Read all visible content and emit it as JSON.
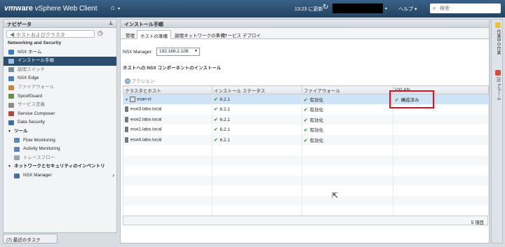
{
  "header": {
    "brand_vm": "vm",
    "brand_ware": "ware",
    "brand_product": " vSphere Web Client",
    "home_icon": "home-icon",
    "updated_text": "13:23 に更新",
    "refresh_icon": "refresh-icon",
    "help_label": "ヘルプ ▾",
    "search_placeholder": "検索",
    "colors": {
      "topbar": "#2c4d6e"
    }
  },
  "navigator": {
    "title": "ナビゲータ",
    "back_label": "◀ ホストおよびクラスタ",
    "items": [
      {
        "label": "Networking and Security",
        "kind": "top"
      },
      {
        "label": "NSX ホーム",
        "icon": "nsx-home-icon",
        "color": "#3a78c2"
      },
      {
        "label": "インストール手順",
        "icon": "install-icon",
        "color": "#5a8fd0",
        "selected": true
      },
      {
        "label": "論理スイッチ",
        "icon": "logical-switch-icon",
        "color": "#7a8a99",
        "dim": true
      },
      {
        "label": "NSX Edge",
        "icon": "nsx-edge-icon",
        "color": "#4f7fb0"
      },
      {
        "label": "ファイアウォール",
        "icon": "firewall-icon",
        "color": "#c8843a",
        "dim": true
      },
      {
        "label": "SpoofGuard",
        "icon": "spoofguard-icon",
        "color": "#6b8e4e"
      },
      {
        "label": "サービス定義",
        "icon": "service-definition-icon",
        "color": "#8a8a8a",
        "dim": true
      },
      {
        "label": "Service Composer",
        "icon": "service-composer-icon",
        "color": "#b04a3a"
      },
      {
        "label": "Data Security",
        "icon": "data-security-icon",
        "color": "#3a6fa8"
      }
    ],
    "tools_section": "ツール",
    "tools": [
      {
        "label": "Flow Monitoring",
        "icon": "flow-monitoring-icon"
      },
      {
        "label": "Activity Monitoring",
        "icon": "activity-monitoring-icon"
      },
      {
        "label": "トレースフロー",
        "icon": "traceflow-icon",
        "dim": true
      }
    ],
    "inventory_section": "ネットワークとセキュリティのインベントリ",
    "inventory": [
      {
        "label": "NSX Manager",
        "icon": "nsx-manager-icon"
      }
    ]
  },
  "recent_tasks": "(7) 最近のタスク",
  "main": {
    "title": "インストール手順",
    "tabs": [
      "管理",
      "ホストの準備",
      "論理ネットワークの準備",
      "サービス デプロイ"
    ],
    "active_tab": 1,
    "nsx_manager_label": "NSX Manager:",
    "nsx_manager_value": "192.168.2.108",
    "section_title": "ホストへの NSX コンポーネントのインストール",
    "actions_label": "アクション",
    "columns": [
      "クラスタとホスト",
      "インストール ステータス",
      "ファイアウォール",
      "VXLAN"
    ],
    "rows": [
      {
        "name": "vsan-cl",
        "type": "cluster",
        "install": "6.2.1",
        "firewall": "有効化",
        "vxlan": "構成済み"
      },
      {
        "name": "esxi3.labo.local",
        "type": "host",
        "install": "6.2.1",
        "firewall": "有効化",
        "vxlan": ""
      },
      {
        "name": "esxi2.labo.local",
        "type": "host",
        "install": "6.2.1",
        "firewall": "有効化",
        "vxlan": ""
      },
      {
        "name": "esxi1.labo.local",
        "type": "host",
        "install": "6.2.1",
        "firewall": "有効化",
        "vxlan": ""
      },
      {
        "name": "esxi4.labo.local",
        "type": "host",
        "install": "6.2.1",
        "firewall": "有効化",
        "vxlan": ""
      }
    ],
    "item_count": "5 項目",
    "highlight_color": "#e0121f"
  },
  "right_panel": {
    "tabs": [
      {
        "label": "作業中の作業",
        "icon": "work-in-progress-icon",
        "color": "#e8c23a"
      },
      {
        "label": "(3) アラーム",
        "icon": "alarm-icon",
        "color": "#d84a3a"
      }
    ]
  }
}
